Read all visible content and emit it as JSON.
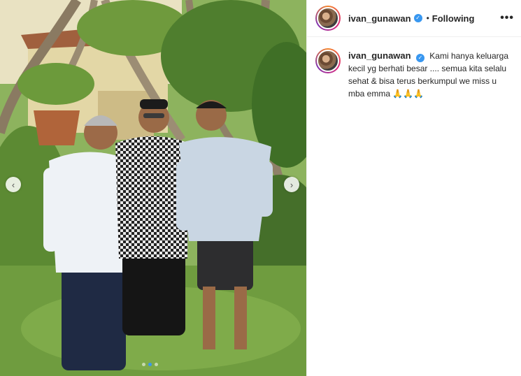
{
  "post": {
    "username": "ivan_gunawan",
    "verified_icon": "verified-badge-icon",
    "separator": "•",
    "follow_status": "Following",
    "more_icon": "•••",
    "caption": "Kami hanya keluarga kecil yg berhati besar .... semua kita selalu sehat & bisa terus berkumpul we miss u mba emma 🙏🙏🙏"
  },
  "carousel": {
    "prev_icon": "‹",
    "next_icon": "›",
    "slide_count": 3,
    "active_slide": 2
  },
  "colors": {
    "accent": "#3897f0",
    "text": "#262626",
    "border": "#efefef"
  }
}
